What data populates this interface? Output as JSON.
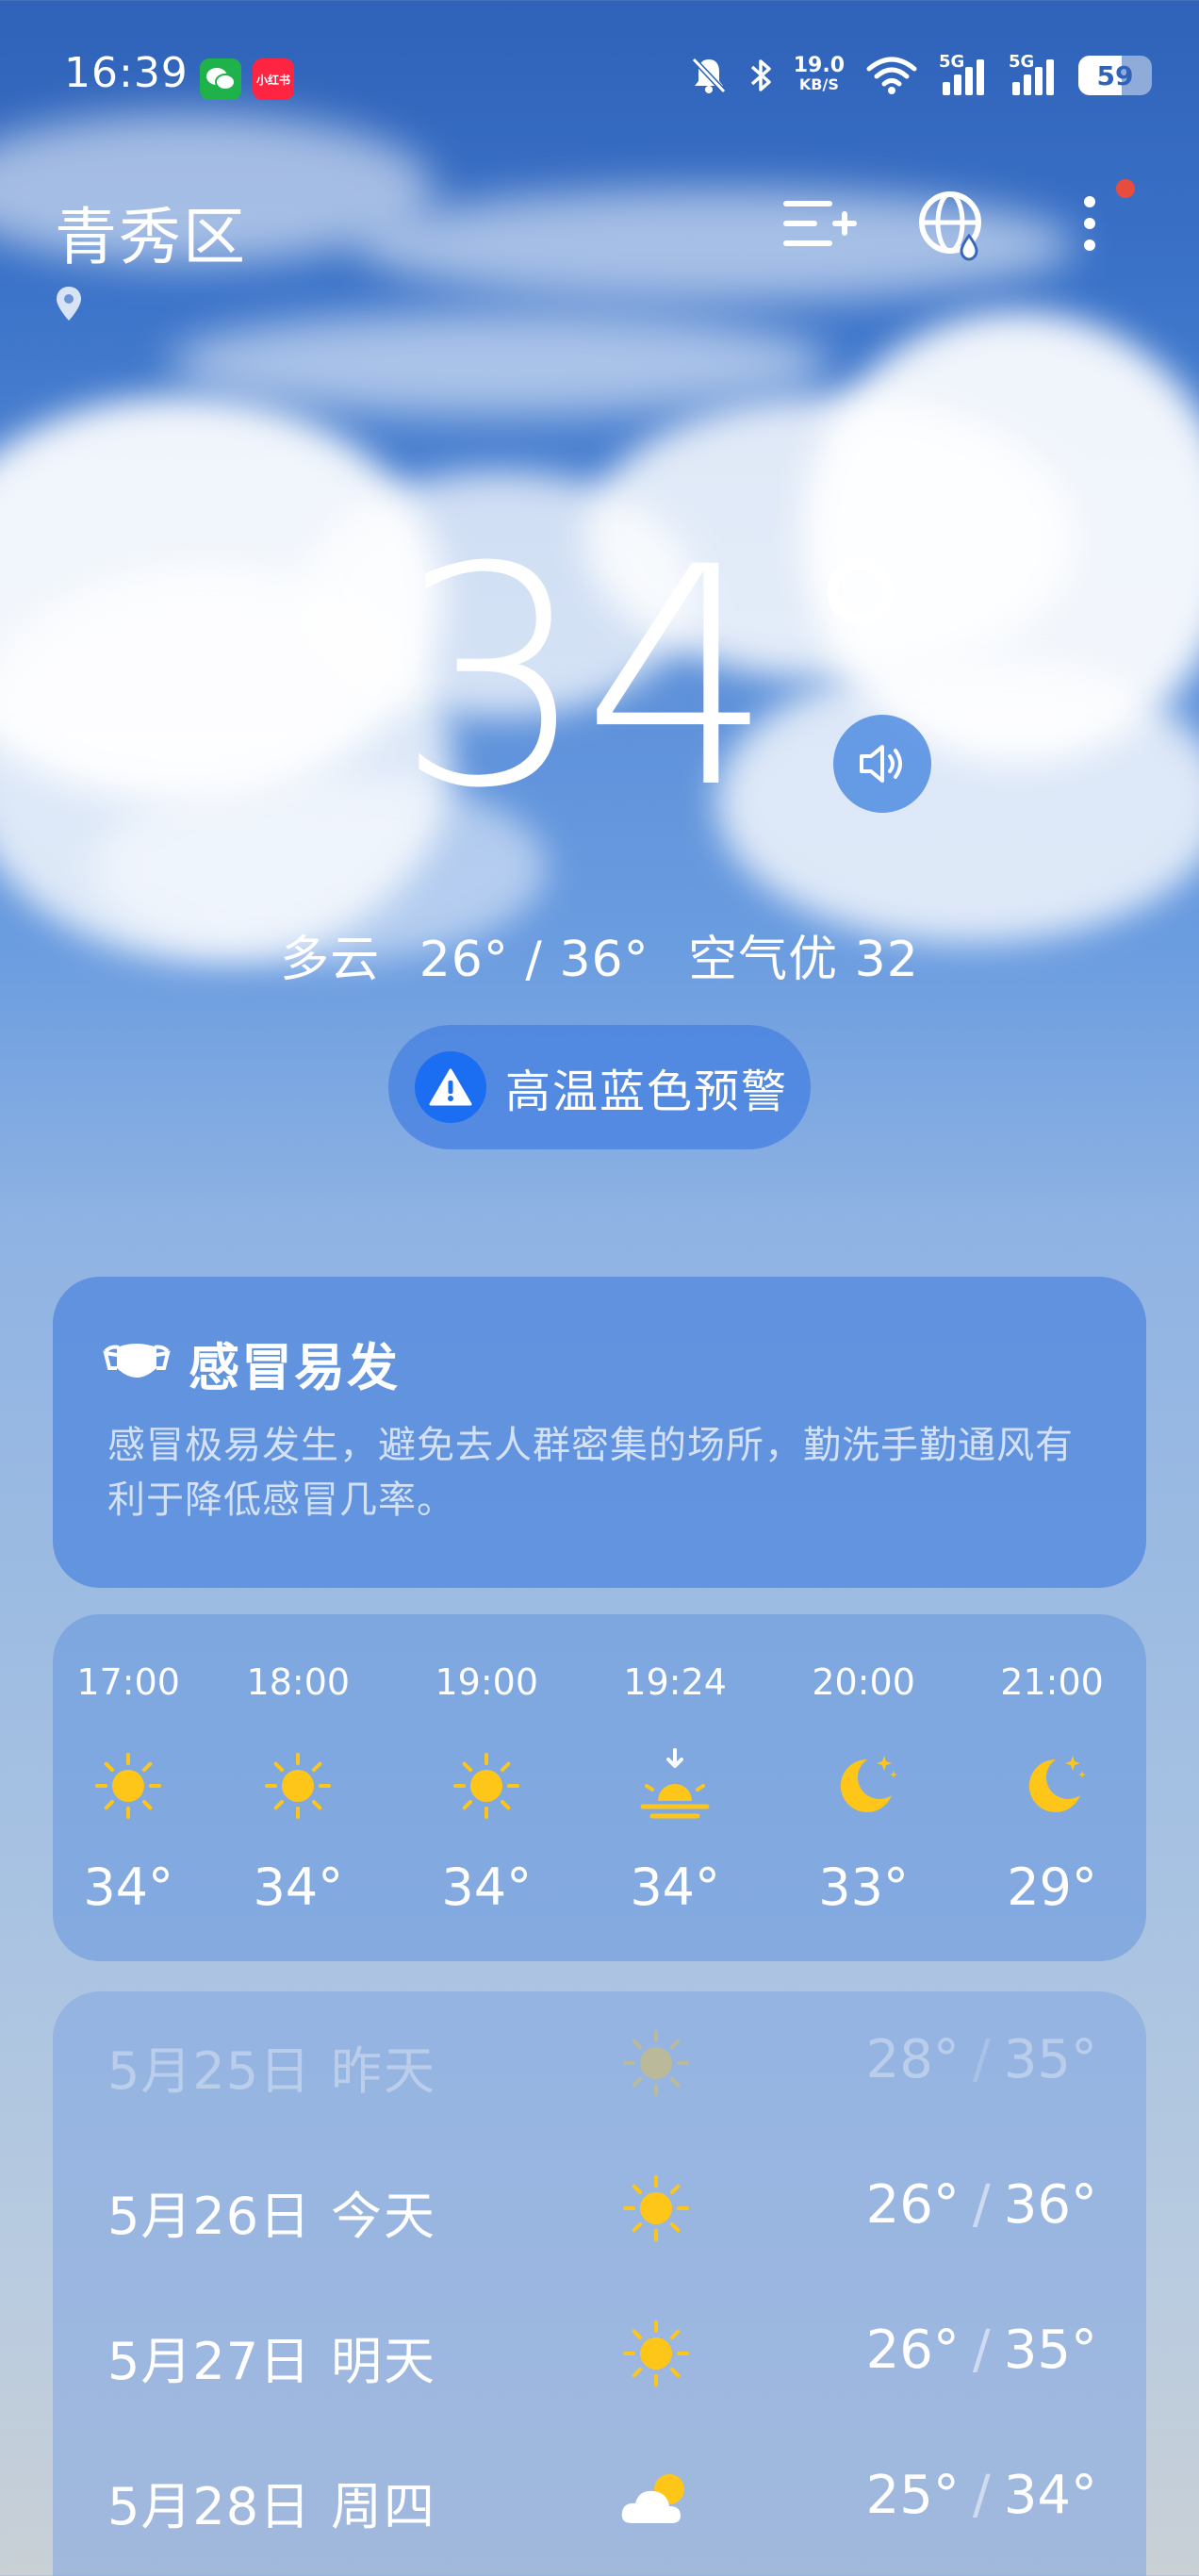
{
  "status_bar": {
    "time": "16:39",
    "apps": [
      "微信",
      "小红书"
    ],
    "net_speed_value": "19.0",
    "net_speed_unit": "KB/S",
    "signal1_label": "5G",
    "signal2_label": "5G",
    "battery_level": "59"
  },
  "header": {
    "city": "青秀区"
  },
  "current": {
    "temperature": "34",
    "condition": "多云",
    "low": "26°",
    "high": "36°",
    "air_quality": "空气优 32"
  },
  "warning": {
    "label": "高温蓝色预警"
  },
  "tip": {
    "title": "感冒易发",
    "body": "感冒极易发生，避免去人群密集的场所，勤洗手勤通风有利于降低感冒几率。"
  },
  "hourly": [
    {
      "time": "17:00",
      "icon": "sun-icon",
      "temp": "34°"
    },
    {
      "time": "18:00",
      "icon": "sun-icon",
      "temp": "34°"
    },
    {
      "time": "19:00",
      "icon": "sun-icon",
      "temp": "34°"
    },
    {
      "time": "19:24",
      "icon": "sunset-icon",
      "temp": "34°"
    },
    {
      "time": "20:00",
      "icon": "moon-icon",
      "temp": "33°"
    },
    {
      "time": "21:00",
      "icon": "moon-icon",
      "temp": "29°"
    }
  ],
  "daily": [
    {
      "date": "5月25日",
      "label": "昨天",
      "icon": "sun-icon",
      "low": "28°",
      "high": "35°"
    },
    {
      "date": "5月26日",
      "label": "今天",
      "icon": "sun-icon",
      "low": "26°",
      "high": "36°"
    },
    {
      "date": "5月27日",
      "label": "明天",
      "icon": "sun-icon",
      "low": "26°",
      "high": "35°"
    },
    {
      "date": "5月28日",
      "label": "周四",
      "icon": "partly-cloudy-icon",
      "low": "25°",
      "high": "34°"
    }
  ],
  "separator": "/",
  "colors": {
    "sun": "#ffc61a",
    "warning_icon_bg": "#1b6df2",
    "notification_dot": "#e84c3d"
  }
}
